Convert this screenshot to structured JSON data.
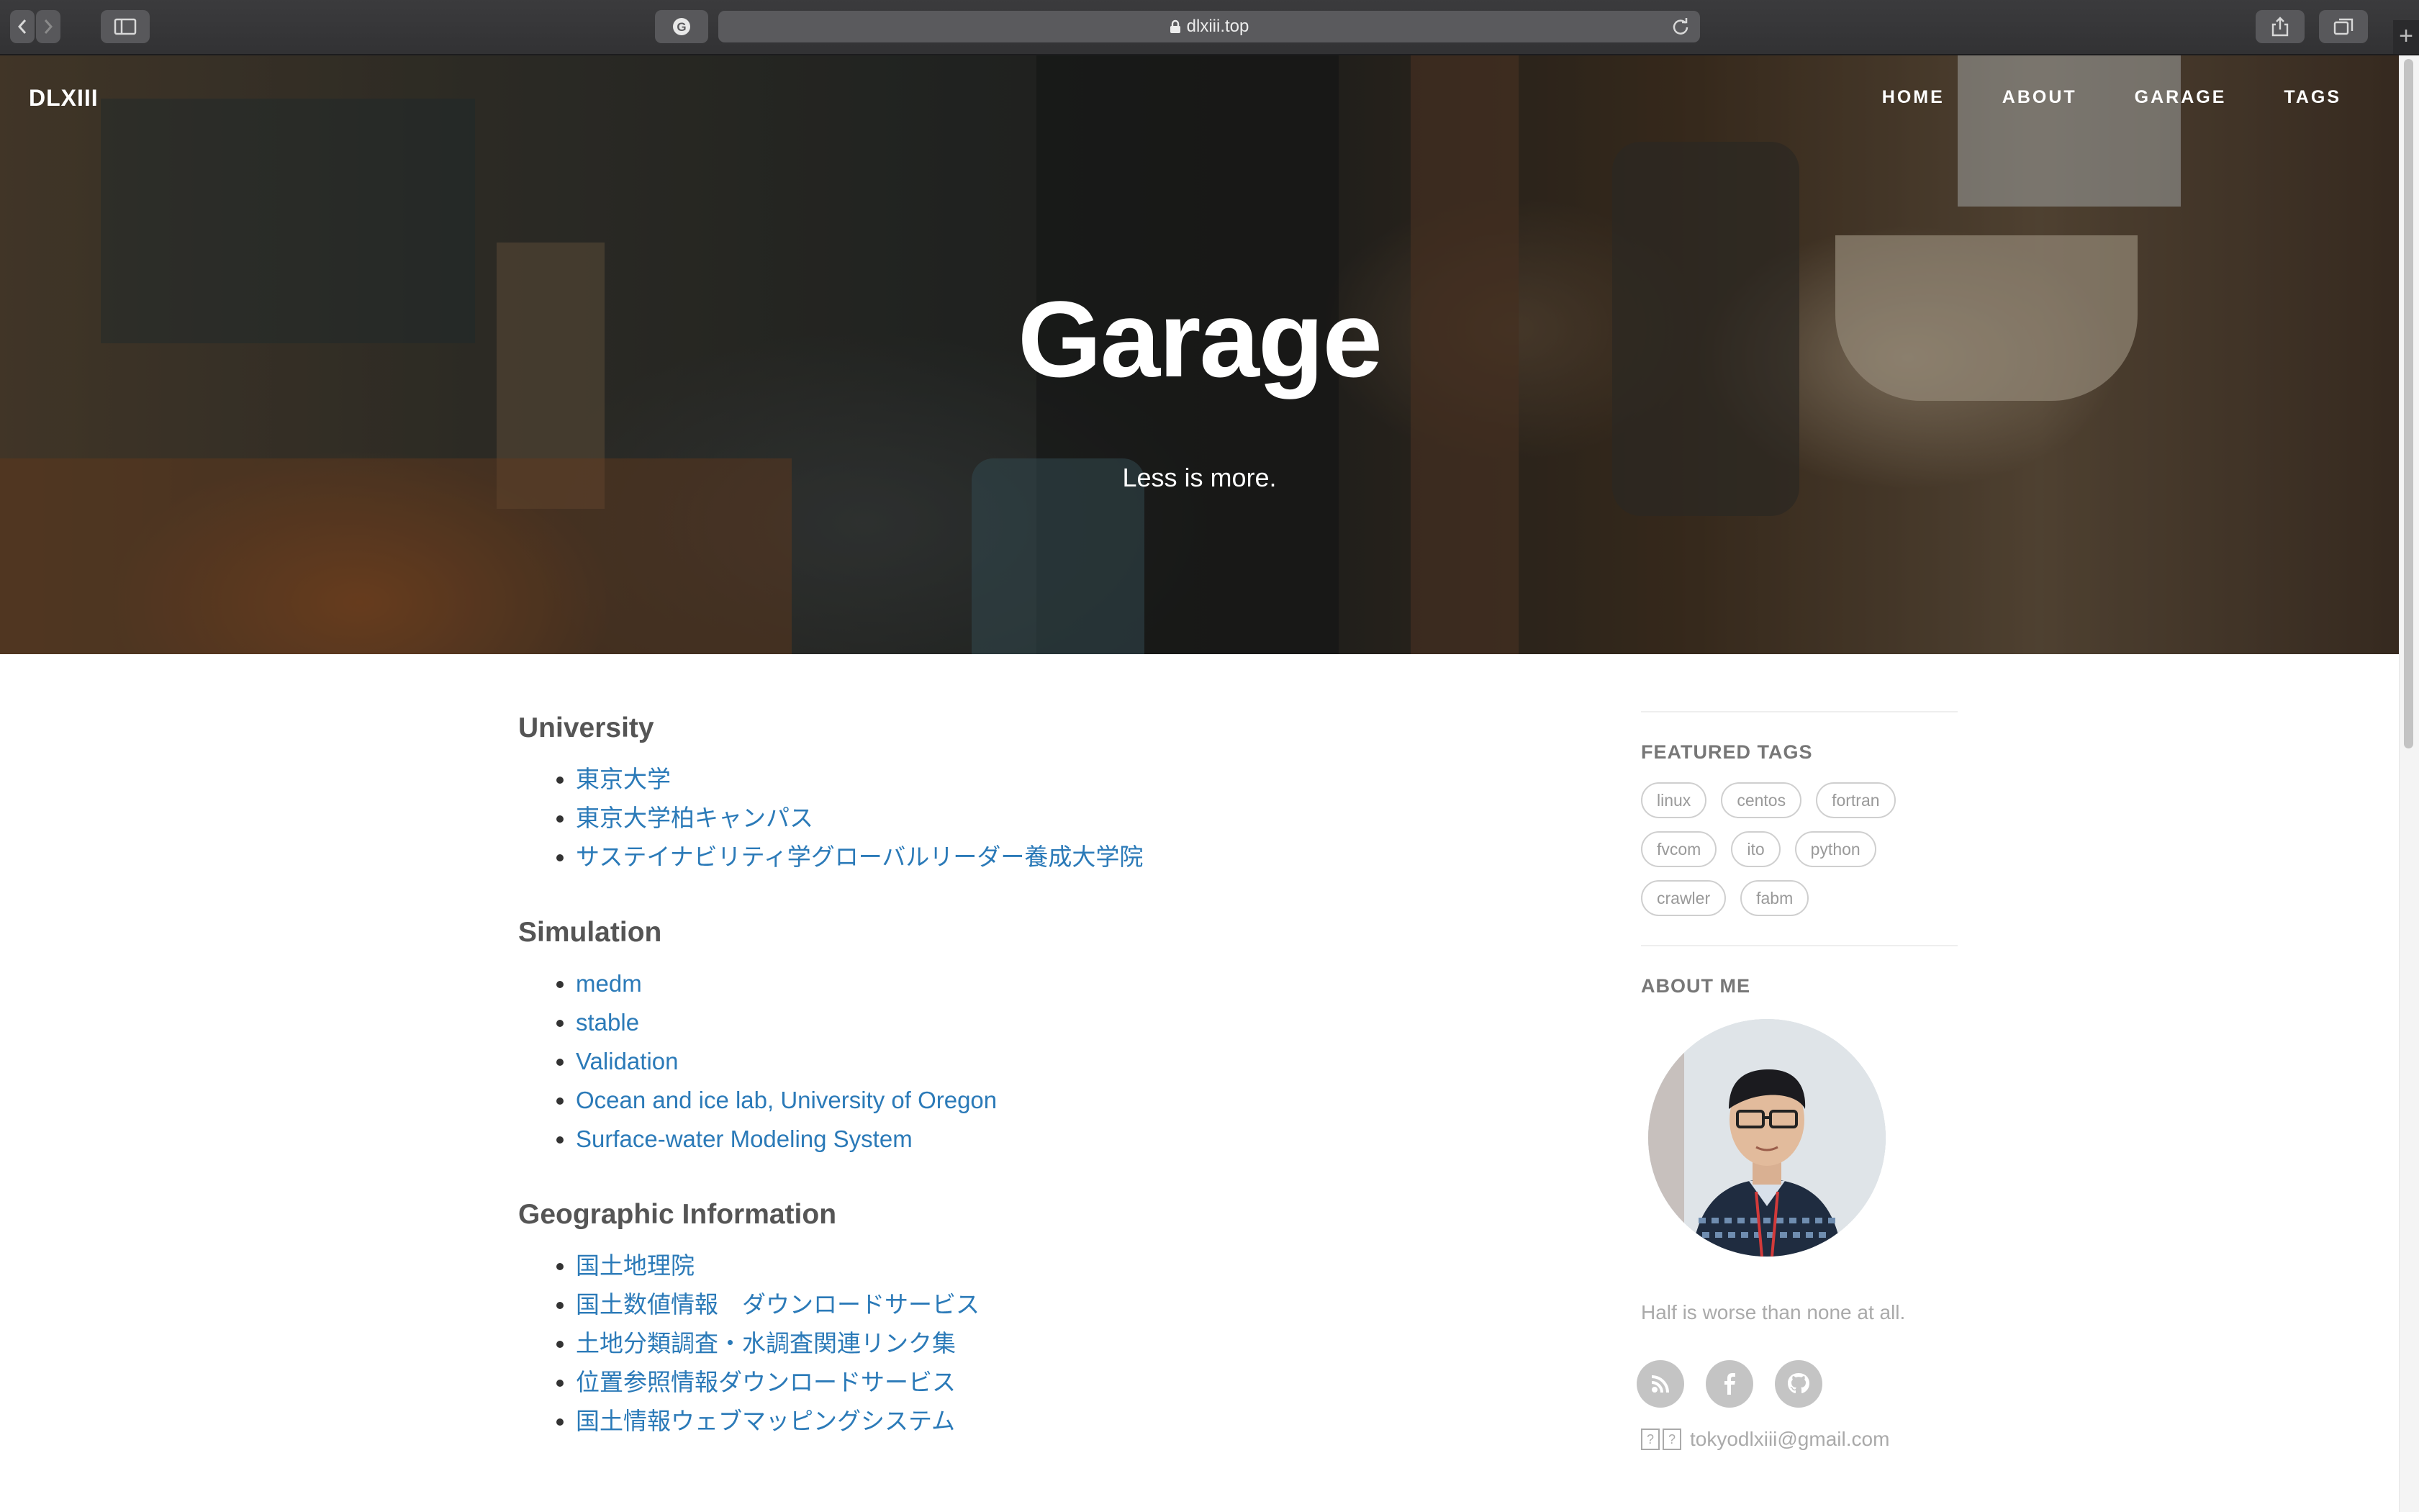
{
  "browser": {
    "url": "dlxiii.top"
  },
  "site": {
    "brand": "DLXIII",
    "nav": [
      "HOME",
      "ABOUT",
      "GARAGE",
      "TAGS"
    ]
  },
  "hero": {
    "title": "Garage",
    "subtitle": "Less is more."
  },
  "sections": [
    {
      "title": "University",
      "links": [
        "東京大学",
        "東京大学柏キャンパス",
        "サステイナビリティ学グローバルリーダー養成大学院"
      ]
    },
    {
      "title": "Simulation",
      "links": [
        "medm",
        "stable",
        "Validation",
        "Ocean and ice lab, University of Oregon",
        "Surface-water Modeling System"
      ]
    },
    {
      "title": "Geographic Information",
      "links": [
        "国土地理院",
        "国土数値情報　ダウンロードサービス",
        "土地分類調査・水調査関連リンク集",
        "位置参照情報ダウンロードサービス",
        "国土情報ウェブマッピングシステム"
      ]
    }
  ],
  "sidebar": {
    "featured_tags_title": "FEATURED TAGS",
    "tags": [
      "linux",
      "centos",
      "fortran",
      "fvcom",
      "ito",
      "python",
      "crawler",
      "fabm"
    ],
    "about_title": "ABOUT ME",
    "motto": "Half is worse than none at all.",
    "social_icons": [
      "rss-icon",
      "facebook-icon",
      "github-icon"
    ],
    "email_glyph": "?",
    "email": "tokyodlxiii@gmail.com"
  }
}
